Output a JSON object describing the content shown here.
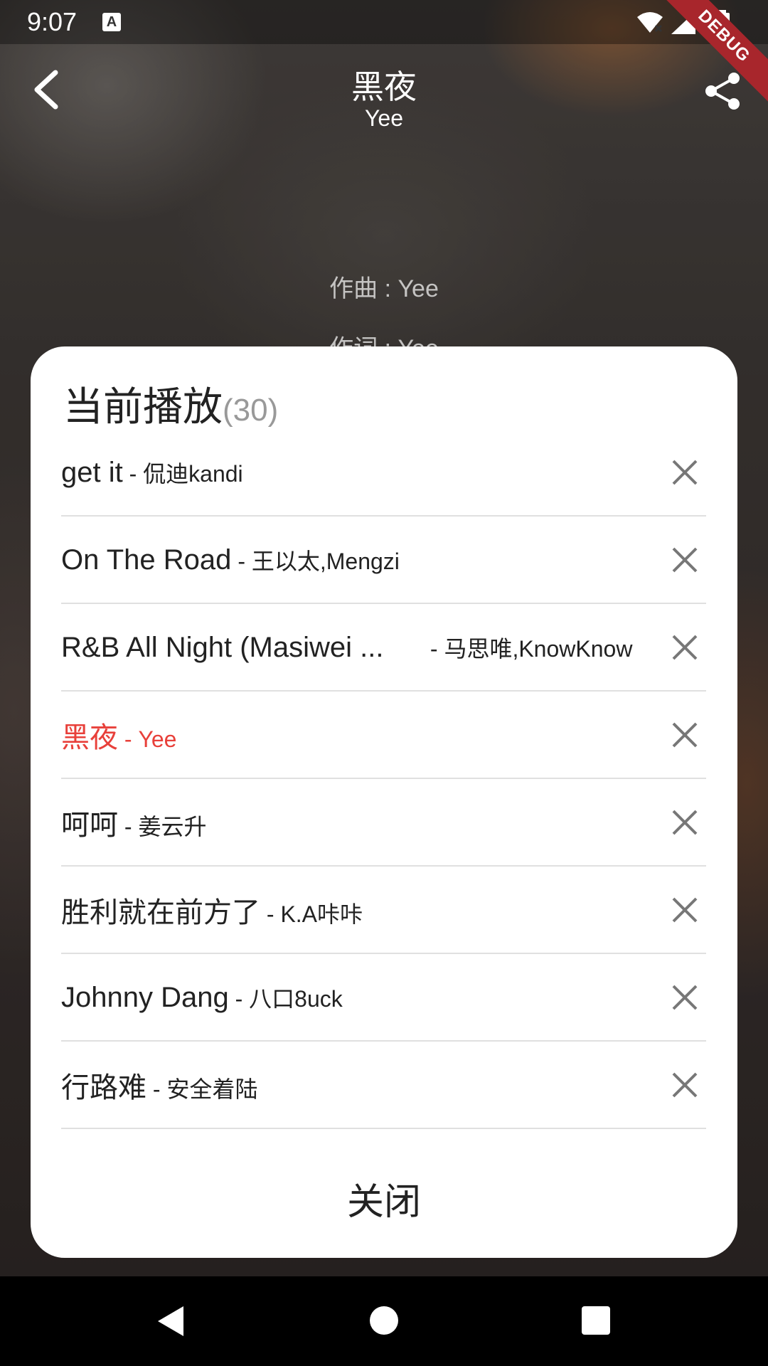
{
  "status_bar": {
    "time": "9:07",
    "debug_label": "DEBUG"
  },
  "header": {
    "title": "黑夜",
    "subtitle": "Yee"
  },
  "lyrics": [
    "作曲 : Yee",
    "作词 : Yee"
  ],
  "playlist": {
    "title": "当前播放",
    "count": "(30)",
    "close_label": "关闭",
    "accent_color": "#e8403a",
    "items": [
      {
        "song": "get it",
        "artist": " - 侃迪kandi"
      },
      {
        "song": "On The Road",
        "artist": " - 王以太,Mengzi"
      },
      {
        "song": "R&B All Night (Masiwei ...",
        "artist": " - 马思唯,KnowKnow"
      },
      {
        "song": "黑夜",
        "artist": " - Yee"
      },
      {
        "song": "呵呵",
        "artist": " - 姜云升"
      },
      {
        "song": "胜利就在前方了",
        "artist": " - K.A咔咔"
      },
      {
        "song": "Johnny Dang",
        "artist": " - 八口8uck"
      },
      {
        "song": "行路难",
        "artist": " - 安全着陆"
      }
    ]
  }
}
